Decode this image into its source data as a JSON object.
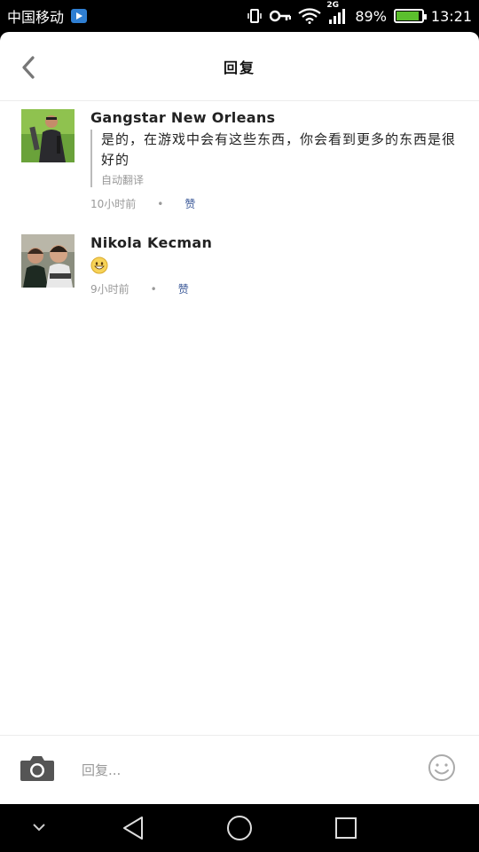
{
  "status_bar": {
    "carrier": "中国移动",
    "network": "2G",
    "battery": "89%",
    "battery_level": 0.89,
    "time": "13:21"
  },
  "header": {
    "title": "回复"
  },
  "comments": [
    {
      "name": "Gangstar New Orleans",
      "text": "是的，在游戏中会有这些东西，你会看到更多的东西是很好的",
      "translation_note": "自动翻译",
      "time": "10小时前",
      "separator": "•",
      "like": "赞"
    },
    {
      "name": "Nikola Kecman",
      "emoji": "grinning-face-icon",
      "time": "9小时前",
      "separator": "•",
      "like": "赞"
    }
  ],
  "composer": {
    "placeholder": "回复..."
  },
  "colors": {
    "like": "#3b5998",
    "battery": "#5bbf2d"
  }
}
